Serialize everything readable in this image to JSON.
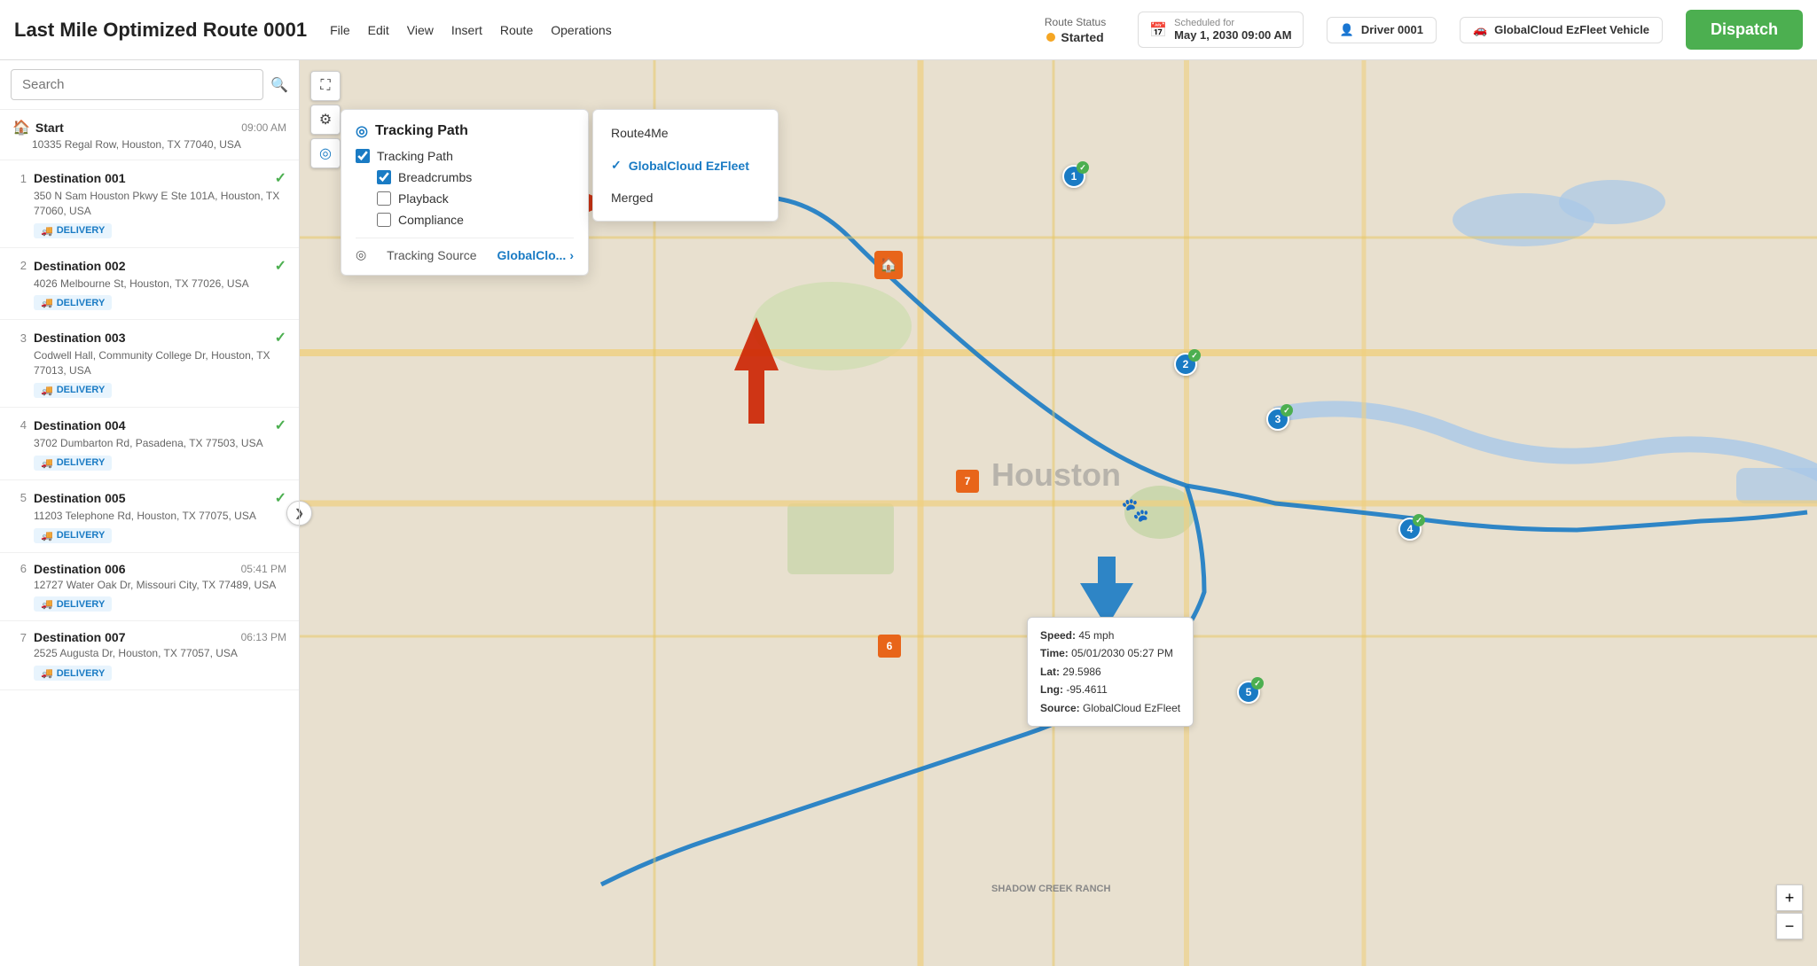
{
  "header": {
    "title": "Last Mile Optimized Route 0001",
    "menu": [
      "File",
      "Edit",
      "View",
      "Insert",
      "Route",
      "Operations"
    ],
    "route_status_label": "Route Status",
    "route_status_value": "Started",
    "scheduled_label": "Scheduled for",
    "scheduled_value": "May 1, 2030 09:00 AM",
    "driver_label": "Driver 0001",
    "vehicle_label": "GlobalCloud EzFleet Vehicle",
    "dispatch_label": "Dispatch"
  },
  "sidebar": {
    "search_placeholder": "Search",
    "start": {
      "name": "Start",
      "address": "10335 Regal Row, Houston, TX 77040, USA",
      "time": "09:00 AM"
    },
    "destinations": [
      {
        "num": "1",
        "name": "Destination 001",
        "address": "350 N Sam Houston Pkwy E Ste 101A, Houston, TX 77060, USA",
        "time": "",
        "badge": "DELIVERY",
        "checked": true
      },
      {
        "num": "2",
        "name": "Destination 002",
        "address": "4026 Melbourne St, Houston, TX 77026, USA",
        "time": "",
        "badge": "DELIVERY",
        "checked": true
      },
      {
        "num": "3",
        "name": "Destination 003",
        "address": "Codwell Hall, Community College Dr, Houston, TX 77013, USA",
        "time": "",
        "badge": "DELIVERY",
        "checked": true
      },
      {
        "num": "4",
        "name": "Destination 004",
        "address": "3702 Dumbarton Rd, Pasadena, TX 77503, USA",
        "time": "",
        "badge": "DELIVERY",
        "checked": true
      },
      {
        "num": "5",
        "name": "Destination 005",
        "address": "11203 Telephone Rd, Houston, TX 77075, USA",
        "time": "",
        "badge": "DELIVERY",
        "checked": true
      },
      {
        "num": "6",
        "name": "Destination 006",
        "address": "12727 Water Oak Dr, Missouri City, TX 77489, USA",
        "time": "05:41 PM",
        "badge": "DELIVERY",
        "checked": false
      },
      {
        "num": "7",
        "name": "Destination 007",
        "address": "2525 Augusta Dr, Houston, TX 77057, USA",
        "time": "06:13 PM",
        "badge": "DELIVERY",
        "checked": false
      }
    ]
  },
  "tracking_popup": {
    "title": "Tracking Path",
    "tracking_path_checked": true,
    "breadcrumbs_checked": true,
    "playback_checked": false,
    "compliance_checked": false,
    "breadcrumbs_label": "Breadcrumbs",
    "playback_label": "Playback",
    "compliance_label": "Compliance",
    "source_label": "Tracking Source",
    "source_value": "GlobalClo..."
  },
  "source_submenu": {
    "items": [
      "Route4Me",
      "GlobalCloud EzFleet",
      "Merged"
    ],
    "selected": "GlobalCloud EzFleet"
  },
  "info_tooltip": {
    "speed": "45 mph",
    "time": "05/01/2030 05:27 PM",
    "lat": "29.5986",
    "lng": "-95.4611",
    "source": "GlobalCloud EzFleet"
  },
  "map_label": "SHADOW CREEK RANCH",
  "zoom_plus": "+",
  "zoom_minus": "−"
}
